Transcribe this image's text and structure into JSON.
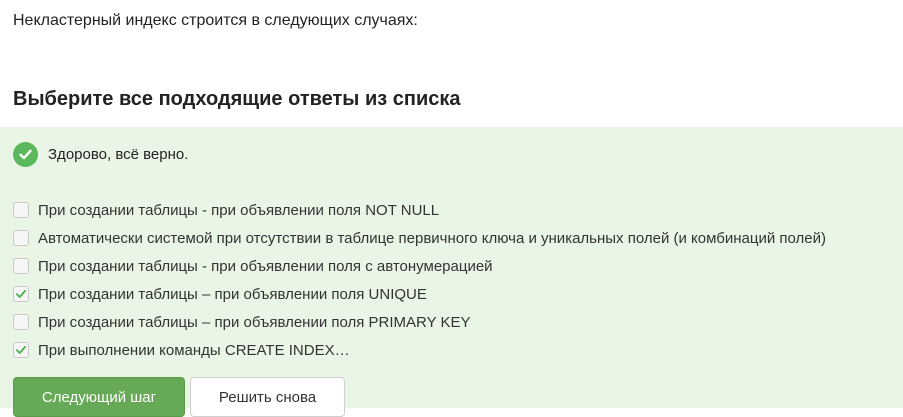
{
  "question_text": "Некластерный индекс строится в следующих случаях:",
  "instruction": "Выберите все подходящие ответы из списка",
  "feedback": {
    "icon": "checkmark-circle-icon",
    "text": "Здорово, всё верно.",
    "color": "#5cb85c"
  },
  "options": [
    {
      "label": "При создании таблицы - при объявлении поля NOT NULL",
      "checked": false
    },
    {
      "label": "Автоматически системой при отсутствии в таблице первичного ключа и уникальных полей (и комбинаций полей)",
      "checked": false
    },
    {
      "label": "При создании таблицы - при объявлении поля с автонумерацией",
      "checked": false
    },
    {
      "label": "При создании таблицы – при объявлении поля UNIQUE",
      "checked": true
    },
    {
      "label": "При создании таблицы – при объявлении поля PRIMARY KEY",
      "checked": false
    },
    {
      "label": "При выполнении команды CREATE INDEX…",
      "checked": true
    }
  ],
  "buttons": {
    "next_label": "Следующий шаг",
    "retry_label": "Решить снова"
  },
  "colors": {
    "panel_background": "#e9f6e6",
    "primary_button": "#66a956",
    "check_mark": "#4caf50"
  }
}
